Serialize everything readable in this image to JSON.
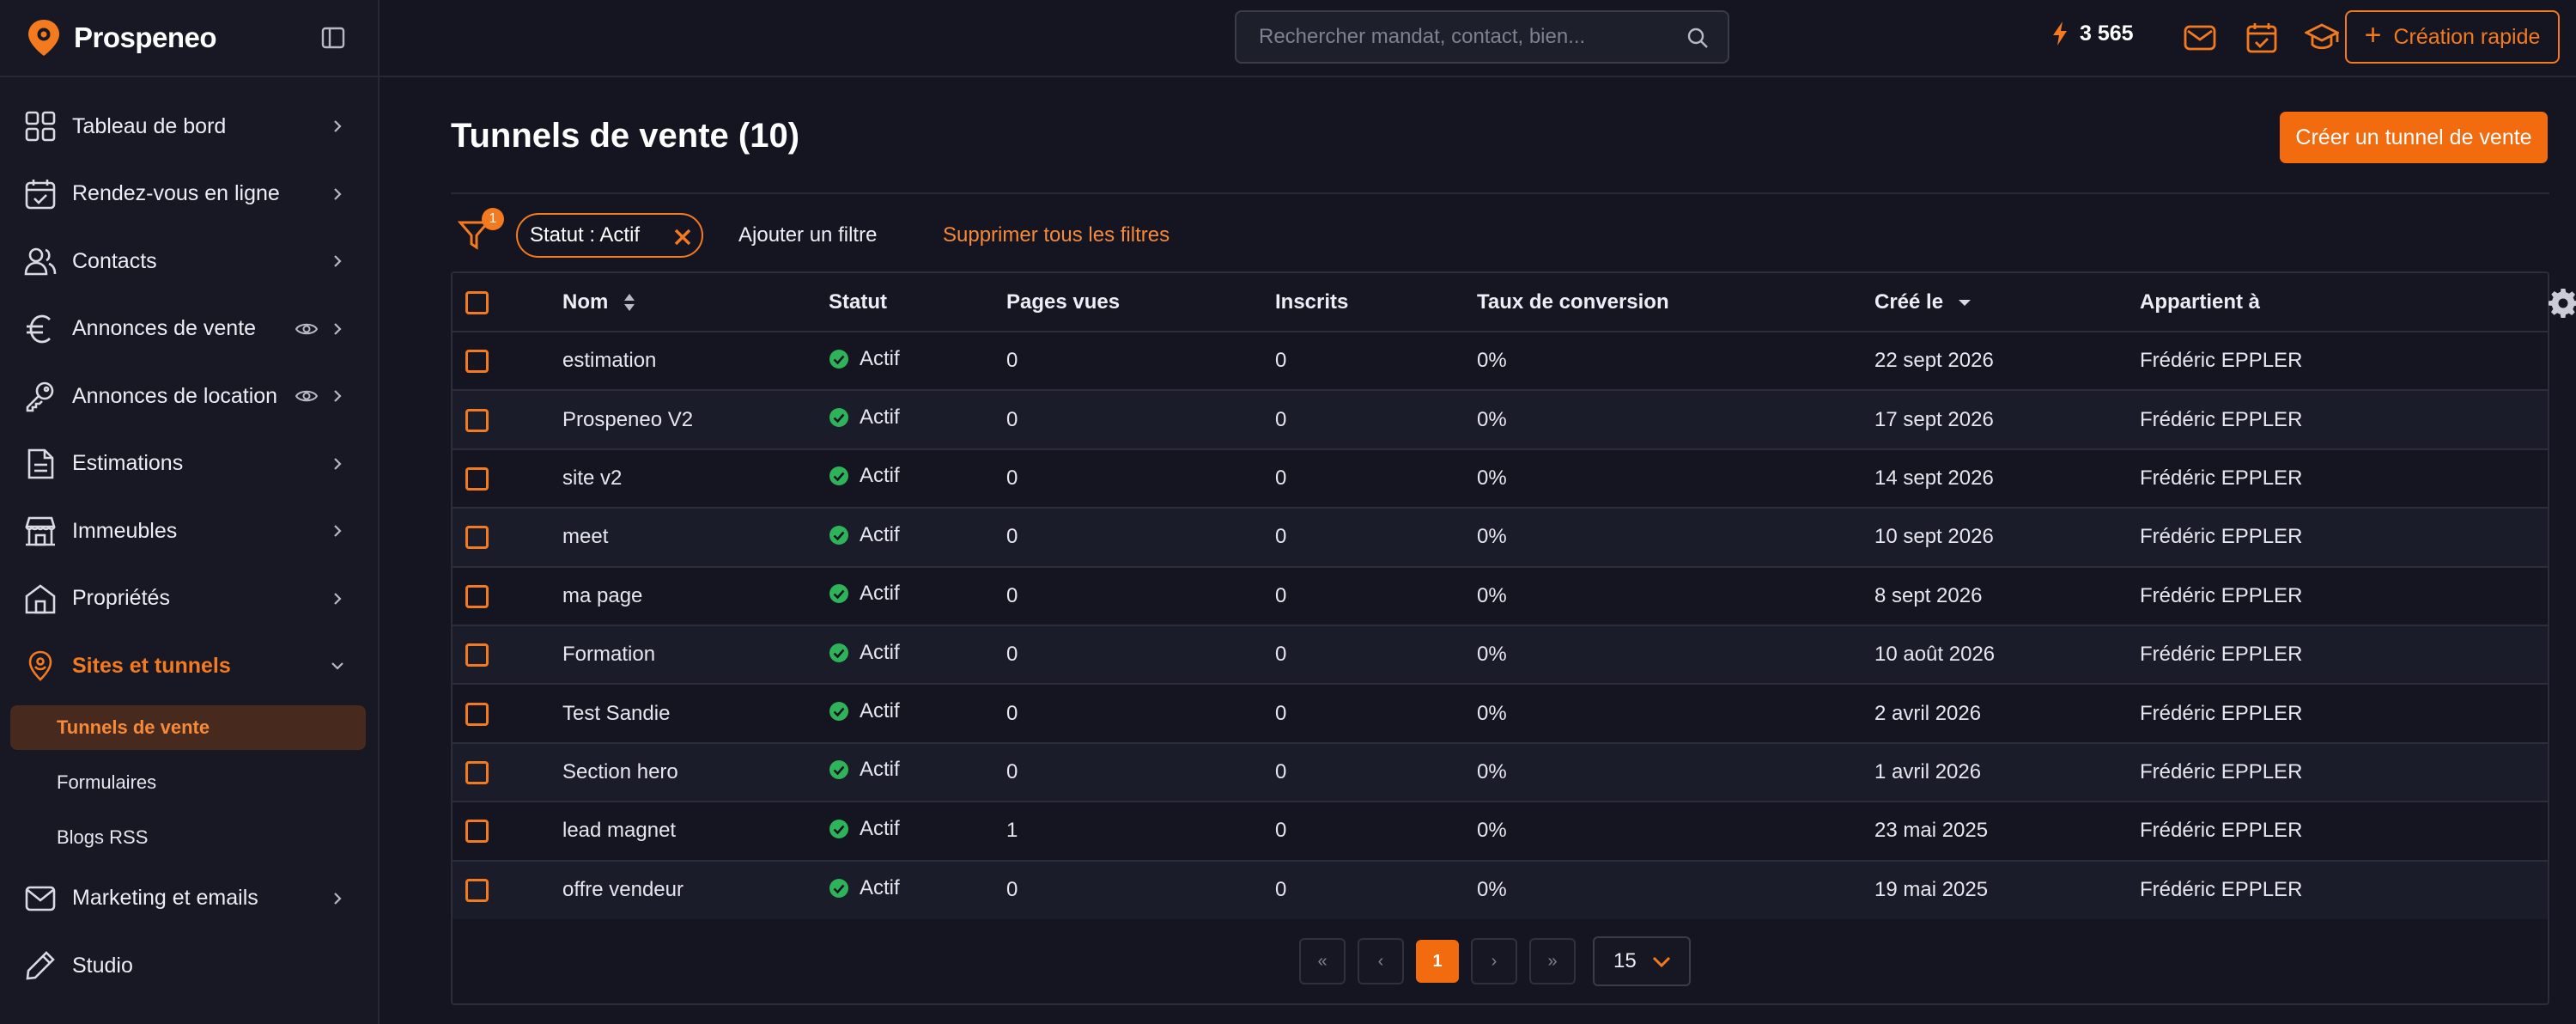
{
  "app": {
    "name": "Prospeneo"
  },
  "sidebar": {
    "items": [
      {
        "label": "Tableau de bord",
        "icon": "grid-icon"
      },
      {
        "label": "Rendez-vous en ligne",
        "icon": "calendar-icon"
      },
      {
        "label": "Contacts",
        "icon": "users-icon"
      },
      {
        "label": "Annonces de vente",
        "icon": "euro-icon"
      },
      {
        "label": "Annonces de location",
        "icon": "key-icon"
      },
      {
        "label": "Estimations",
        "icon": "document-icon"
      },
      {
        "label": "Immeubles",
        "icon": "building-icon"
      },
      {
        "label": "Propriétés",
        "icon": "house-icon"
      },
      {
        "label": "Sites et tunnels",
        "icon": "location-pin-icon"
      },
      {
        "label": "Marketing et emails",
        "icon": "mail-icon"
      },
      {
        "label": "Studio",
        "icon": "pencil-icon"
      }
    ],
    "sub_items": [
      {
        "label": "Tunnels de vente"
      },
      {
        "label": "Formulaires"
      },
      {
        "label": "Blogs RSS"
      }
    ]
  },
  "topbar": {
    "search_placeholder": "Rechercher mandat, contact, bien...",
    "credits": "3 565",
    "quick_create": "Création rapide"
  },
  "page": {
    "title": "Tunnels de vente (10)",
    "create_button": "Créer un tunnel de vente"
  },
  "filters": {
    "badge": "1",
    "chip": "Statut : Actif",
    "add": "Ajouter un filtre",
    "clear": "Supprimer tous les filtres"
  },
  "table": {
    "columns": [
      "Nom",
      "Statut",
      "Pages vues",
      "Inscrits",
      "Taux de conversion",
      "Créé le",
      "Appartient à"
    ],
    "rows": [
      {
        "nom": "estimation",
        "statut": "Actif",
        "pages": "0",
        "inscrits": "0",
        "taux": "0%",
        "cree": "22 sept 2026",
        "owner": "Frédéric EPPLER"
      },
      {
        "nom": "Prospeneo V2",
        "statut": "Actif",
        "pages": "0",
        "inscrits": "0",
        "taux": "0%",
        "cree": "17 sept 2026",
        "owner": "Frédéric EPPLER"
      },
      {
        "nom": "site v2",
        "statut": "Actif",
        "pages": "0",
        "inscrits": "0",
        "taux": "0%",
        "cree": "14 sept 2026",
        "owner": "Frédéric EPPLER"
      },
      {
        "nom": "meet",
        "statut": "Actif",
        "pages": "0",
        "inscrits": "0",
        "taux": "0%",
        "cree": "10 sept 2026",
        "owner": "Frédéric EPPLER"
      },
      {
        "nom": "ma page",
        "statut": "Actif",
        "pages": "0",
        "inscrits": "0",
        "taux": "0%",
        "cree": "8 sept 2026",
        "owner": "Frédéric EPPLER"
      },
      {
        "nom": "Formation",
        "statut": "Actif",
        "pages": "0",
        "inscrits": "0",
        "taux": "0%",
        "cree": "10 août 2026",
        "owner": "Frédéric EPPLER"
      },
      {
        "nom": "Test Sandie",
        "statut": "Actif",
        "pages": "0",
        "inscrits": "0",
        "taux": "0%",
        "cree": "2 avril 2026",
        "owner": "Frédéric EPPLER"
      },
      {
        "nom": "Section hero",
        "statut": "Actif",
        "pages": "0",
        "inscrits": "0",
        "taux": "0%",
        "cree": "1 avril 2026",
        "owner": "Frédéric EPPLER"
      },
      {
        "nom": "lead magnet",
        "statut": "Actif",
        "pages": "1",
        "inscrits": "0",
        "taux": "0%",
        "cree": "23 mai 2025",
        "owner": "Frédéric EPPLER"
      },
      {
        "nom": "offre vendeur",
        "statut": "Actif",
        "pages": "0",
        "inscrits": "0",
        "taux": "0%",
        "cree": "19 mai 2025",
        "owner": "Frédéric EPPLER"
      }
    ]
  },
  "pagination": {
    "first": "«",
    "prev": "‹",
    "current": "1",
    "next": "›",
    "last": "»",
    "page_size": "15"
  },
  "colors": {
    "accent": "#f47a20",
    "success": "#2fb35a",
    "background": "#141520"
  }
}
